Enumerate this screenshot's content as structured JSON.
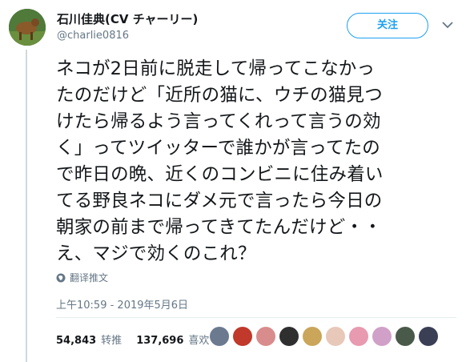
{
  "user": {
    "display_name": "石川佳典(CV チャーリー)",
    "handle": "@charlie0816"
  },
  "follow_label": "关注",
  "tweet_text": "ネコが2日前に脱走して帰ってこなかっ\nたのだけど「近所の猫に、ウチの猫見つ\nけたら帰るよう言ってくれって言うの効\nく」ってツイッターで誰かが言ってたの\nで昨日の晩、近くのコンビニに住み着い\nてる野良ネコにダメ元で言ったら今日の\n朝家の前まで帰ってきてたんだけど・・\nえ、マジで効くのこれ？",
  "translate_label": "翻译推文",
  "timestamp": "上午10:59 - 2019年5月6日",
  "stats": {
    "retweet_count": "54,843",
    "retweet_label": "转推",
    "like_count": "137,696",
    "like_label": "喜欢"
  },
  "likers": [
    {
      "color": "#6b7a8f"
    },
    {
      "color": "#c0392b"
    },
    {
      "color": "#d98c8c"
    },
    {
      "color": "#2f2f2f"
    },
    {
      "color": "#caa55a"
    },
    {
      "color": "#e8c8b8"
    },
    {
      "color": "#e89ab0"
    },
    {
      "color": "#d0a0c8"
    },
    {
      "color": "#4a5a4a"
    },
    {
      "color": "#3a3f55"
    }
  ]
}
